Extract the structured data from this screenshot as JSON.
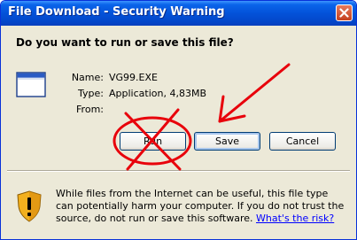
{
  "window": {
    "title": "File Download - Security Warning"
  },
  "question": "Do you want to run or save this file?",
  "file": {
    "name_label": "Name:",
    "name_value": "VG99.EXE",
    "type_label": "Type:",
    "type_value": "Application, 4,83MB",
    "from_label": "From:",
    "from_value": ""
  },
  "buttons": {
    "run": "Run",
    "save": "Save",
    "cancel": "Cancel"
  },
  "warning": {
    "text": "While files from the Internet can be useful, this file type can potentially harm your computer. If you do not trust the source, do not run or save this software.",
    "link": "What's the risk?"
  },
  "colors": {
    "titlebar": "#0352d9",
    "annotation": "#e8000b",
    "dialog_bg": "#ece9d8",
    "link": "#0000ff"
  },
  "icons": {
    "close": "close-icon",
    "file": "application-file-icon",
    "warning": "warning-shield-icon"
  }
}
